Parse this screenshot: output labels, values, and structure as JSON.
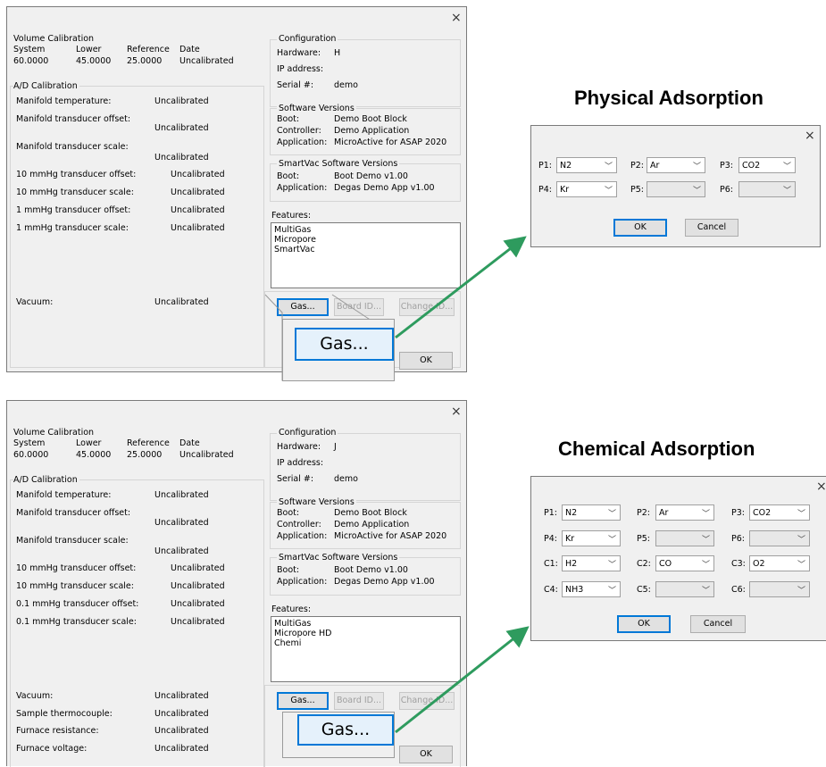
{
  "headings": {
    "physical": "Physical Adsorption",
    "chemical": "Chemical Adsorption"
  },
  "close_glyph": "×",
  "combo_arrow": "﹀",
  "main1": {
    "vol": {
      "title": "Volume Calibration",
      "h_system": "System",
      "h_lower": "Lower",
      "h_reference": "Reference",
      "h_date": "Date",
      "v_system": "60.0000",
      "v_lower": "45.0000",
      "v_reference": "25.0000",
      "v_date": "Uncalibrated"
    },
    "ad_title": "A/D Calibration",
    "ad_rows": [
      {
        "label": "Manifold temperature:",
        "value": "Uncalibrated"
      },
      {
        "label": "Manifold transducer offset:",
        "value": "Uncalibrated"
      },
      {
        "label": "Manifold transducer scale:",
        "value": "Uncalibrated"
      },
      {
        "label": "10 mmHg transducer offset:",
        "value": "Uncalibrated"
      },
      {
        "label": "10 mmHg transducer scale:",
        "value": "Uncalibrated"
      },
      {
        "label": "1 mmHg transducer offset:",
        "value": "Uncalibrated"
      },
      {
        "label": "1 mmHg transducer scale:",
        "value": "Uncalibrated"
      }
    ],
    "vacuum": {
      "label": "Vacuum:",
      "value": "Uncalibrated"
    },
    "config": {
      "title": "Configuration",
      "hardware_label": "Hardware:",
      "hardware_value": "H",
      "ip_label": "IP address:",
      "serial_label": "Serial #:",
      "serial_value": "demo"
    },
    "sw": {
      "title": "Software Versions",
      "boot_label": "Boot:",
      "boot_value": "Demo Boot Block",
      "ctrl_label": "Controller:",
      "ctrl_value": "Demo Application",
      "app_label": "Application:",
      "app_value": "MicroActive for ASAP 2020"
    },
    "svac": {
      "title": "SmartVac Software Versions",
      "boot_label": "Boot:",
      "boot_value": "Boot Demo v1.00",
      "app_label": "Application:",
      "app_value": "Degas Demo App v1.00"
    },
    "features": {
      "title": "Features:",
      "items": [
        "MultiGas",
        "Micropore",
        "SmartVac"
      ]
    },
    "buttons": {
      "gas": "Gas...",
      "board": "Board ID...",
      "change": "Change ID...",
      "ok": "OK"
    }
  },
  "main2": {
    "vol": {
      "title": "Volume Calibration",
      "h_system": "System",
      "h_lower": "Lower",
      "h_reference": "Reference",
      "h_date": "Date",
      "v_system": "60.0000",
      "v_lower": "45.0000",
      "v_reference": "25.0000",
      "v_date": "Uncalibrated"
    },
    "ad_title": "A/D Calibration",
    "ad_rows": [
      {
        "label": "Manifold temperature:",
        "value": "Uncalibrated"
      },
      {
        "label": "Manifold transducer offset:",
        "value": "Uncalibrated"
      },
      {
        "label": "Manifold transducer scale:",
        "value": "Uncalibrated"
      },
      {
        "label": "10 mmHg transducer offset:",
        "value": "Uncalibrated"
      },
      {
        "label": "10 mmHg transducer scale:",
        "value": "Uncalibrated"
      },
      {
        "label": "0.1 mmHg transducer offset:",
        "value": "Uncalibrated"
      },
      {
        "label": "0.1 mmHg transducer scale:",
        "value": "Uncalibrated"
      }
    ],
    "bottom_rows": [
      {
        "label": "Vacuum:",
        "value": "Uncalibrated"
      },
      {
        "label": "Sample thermocouple:",
        "value": "Uncalibrated"
      },
      {
        "label": "Furnace resistance:",
        "value": "Uncalibrated"
      },
      {
        "label": "Furnace voltage:",
        "value": "Uncalibrated"
      }
    ],
    "config": {
      "title": "Configuration",
      "hardware_label": "Hardware:",
      "hardware_value": "J",
      "ip_label": "IP address:",
      "serial_label": "Serial #:",
      "serial_value": "demo"
    },
    "sw": {
      "title": "Software Versions",
      "boot_label": "Boot:",
      "boot_value": "Demo Boot Block",
      "ctrl_label": "Controller:",
      "ctrl_value": "Demo Application",
      "app_label": "Application:",
      "app_value": "MicroActive for ASAP 2020"
    },
    "svac": {
      "title": "SmartVac Software Versions",
      "boot_label": "Boot:",
      "boot_value": "Boot Demo v1.00",
      "app_label": "Application:",
      "app_value": "Degas Demo App v1.00"
    },
    "features": {
      "title": "Features:",
      "items": [
        "MultiGas",
        "Micropore HD",
        "Chemi"
      ]
    },
    "buttons": {
      "gas": "Gas...",
      "board": "Board ID...",
      "change": "Change ID...",
      "ok": "OK"
    }
  },
  "gas1": {
    "fields": [
      {
        "label": "P1:",
        "value": "N2"
      },
      {
        "label": "P2:",
        "value": "Ar"
      },
      {
        "label": "P3:",
        "value": "CO2"
      },
      {
        "label": "P4:",
        "value": "Kr"
      },
      {
        "label": "P5:",
        "value": ""
      },
      {
        "label": "P6:",
        "value": ""
      }
    ],
    "ok": "OK",
    "cancel": "Cancel"
  },
  "gas2": {
    "fields": [
      {
        "label": "P1:",
        "value": "N2"
      },
      {
        "label": "P2:",
        "value": "Ar"
      },
      {
        "label": "P3:",
        "value": "CO2"
      },
      {
        "label": "P4:",
        "value": "Kr"
      },
      {
        "label": "P5:",
        "value": ""
      },
      {
        "label": "P6:",
        "value": ""
      },
      {
        "label": "C1:",
        "value": "H2"
      },
      {
        "label": "C2:",
        "value": "CO"
      },
      {
        "label": "C3:",
        "value": "O2"
      },
      {
        "label": "C4:",
        "value": "NH3"
      },
      {
        "label": "C5:",
        "value": ""
      },
      {
        "label": "C6:",
        "value": ""
      }
    ],
    "ok": "OK",
    "cancel": "Cancel"
  },
  "zoom_label": "Gas...",
  "colors": {
    "arrow": "#2e9b5e",
    "focus_blue": "#0078d7"
  }
}
